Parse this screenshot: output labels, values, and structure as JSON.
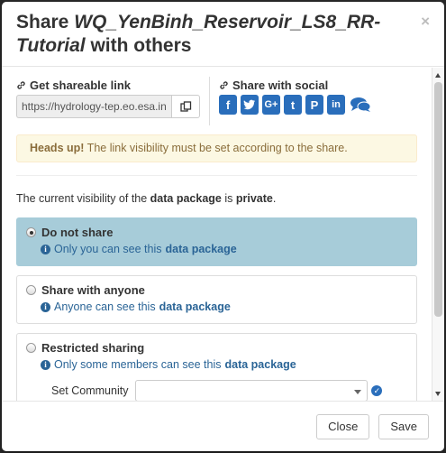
{
  "dialog": {
    "title_prefix": "Share ",
    "title_item": "WQ_YenBinh_Reservoir_LS8_RR-Tutorial",
    "title_suffix": " with others",
    "close_label": "×"
  },
  "share_link": {
    "label": "Get shareable link",
    "value": "https://hydrology-tep.eo.esa.int/"
  },
  "social": {
    "label": "Share with social",
    "items": [
      {
        "name": "facebook-icon",
        "glyph": "f"
      },
      {
        "name": "twitter-icon",
        "glyph": "t"
      },
      {
        "name": "google-plus-icon",
        "glyph": "G+"
      },
      {
        "name": "tumblr-icon",
        "glyph": "t"
      },
      {
        "name": "pinterest-icon",
        "glyph": "P"
      },
      {
        "name": "linkedin-icon",
        "glyph": "in"
      },
      {
        "name": "chat-icon",
        "glyph": ""
      }
    ]
  },
  "alert": {
    "strong": "Heads up!",
    "text": " The link visibility must be set according to the share."
  },
  "visibility": {
    "prefix": "The current visibility of the ",
    "object": "data package",
    "middle": " is ",
    "state": "private",
    "suffix": "."
  },
  "options": [
    {
      "label": "Do not share",
      "info_prefix": "Only you can see this ",
      "info_object": "data package",
      "selected": true
    },
    {
      "label": "Share with anyone",
      "info_prefix": "Anyone can see this ",
      "info_object": "data package",
      "selected": false
    },
    {
      "label": "Restricted sharing",
      "info_prefix": "Only some members can see this ",
      "info_object": "data package",
      "selected": false
    }
  ],
  "community": {
    "label": "Set Community",
    "value": ""
  },
  "footer": {
    "close_label": "Close",
    "save_label": "Save"
  },
  "colors": {
    "active_option_bg": "#a7ccd9",
    "brand_blue": "#2a6ebb",
    "alert_bg": "#fcf8e3"
  }
}
